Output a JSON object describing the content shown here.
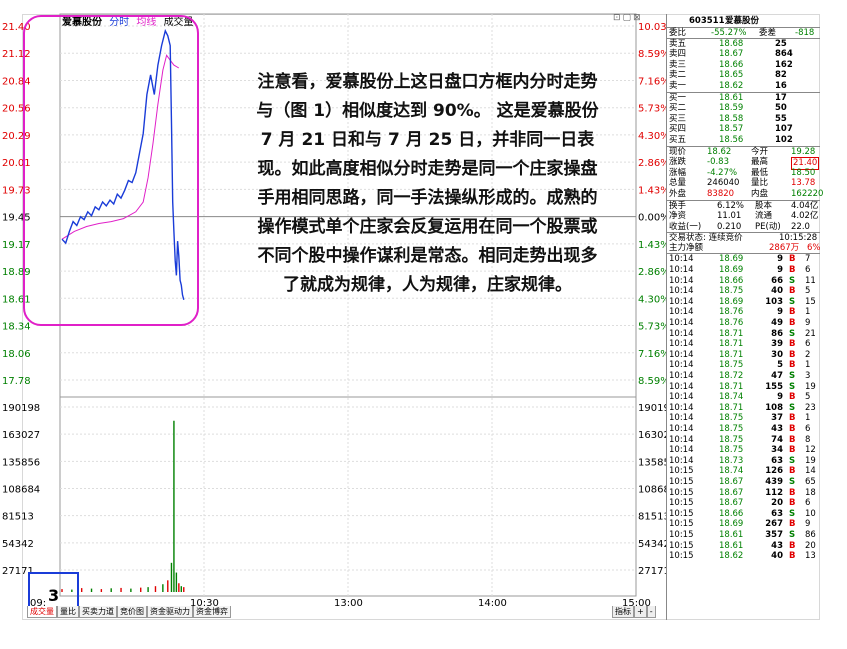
{
  "title_bar": {
    "stock_name": "爱慕股份",
    "tab_intraday": "分时",
    "tab_avg": "均线",
    "tab_volume": "成交量"
  },
  "window_icons": [
    "⊡",
    "▢",
    "⊠"
  ],
  "price_axis": {
    "left": [
      {
        "v": "21.40",
        "c": "red"
      },
      {
        "v": "21.12",
        "c": "red"
      },
      {
        "v": "20.84",
        "c": "red"
      },
      {
        "v": "20.56",
        "c": "red"
      },
      {
        "v": "20.29",
        "c": "red"
      },
      {
        "v": "20.01",
        "c": "red"
      },
      {
        "v": "19.73",
        "c": "red"
      },
      {
        "v": "19.45",
        "c": "black"
      },
      {
        "v": "19.17",
        "c": "green"
      },
      {
        "v": "18.89",
        "c": "green"
      },
      {
        "v": "18.61",
        "c": "green"
      },
      {
        "v": "18.34",
        "c": "green"
      },
      {
        "v": "18.06",
        "c": "green"
      },
      {
        "v": "17.78",
        "c": "green"
      }
    ],
    "right": [
      {
        "v": "10.03%",
        "c": "red"
      },
      {
        "v": "8.59%",
        "c": "red"
      },
      {
        "v": "7.16%",
        "c": "red"
      },
      {
        "v": "5.73%",
        "c": "red"
      },
      {
        "v": "4.30%",
        "c": "red"
      },
      {
        "v": "2.86%",
        "c": "red"
      },
      {
        "v": "1.43%",
        "c": "red"
      },
      {
        "v": "0.00%",
        "c": "black"
      },
      {
        "v": "1.43%",
        "c": "green"
      },
      {
        "v": "2.86%",
        "c": "green"
      },
      {
        "v": "4.30%",
        "c": "green"
      },
      {
        "v": "5.73%",
        "c": "green"
      },
      {
        "v": "7.16%",
        "c": "green"
      },
      {
        "v": "8.59%",
        "c": "green"
      }
    ]
  },
  "volume_axis": {
    "left": [
      "190198",
      "163027",
      "135856",
      "108684",
      "81513",
      "54342",
      "27171"
    ],
    "right": [
      "190198",
      "163027",
      "135856",
      "108684",
      "81513",
      "54342",
      "27171"
    ]
  },
  "time_axis": [
    "09:",
    "10:30",
    "13:00",
    "14:00",
    "15:00"
  ],
  "annotation": {
    "paragraph": "注意看，爱慕股份上这日盘口方框内分时走势与（图 1）相似度达到 90%。 这是爱慕股份 7 月 21 日和与 7 月 25 日，并非同一日表现。如此高度相似分时走势是同一个庄家操盘手用相同思路，同一手法操纵形成的。成熟的操作模式单个庄家会反复运用在同一个股票或不同个股中操作谋利是常态。相同走势出现多了就成为规律，人为规律，庄家规律。",
    "number": "3"
  },
  "bottom_tabs": [
    "成交量",
    "量比",
    "买卖力道",
    "竞价图",
    "资金驱动力",
    "资金博弈"
  ],
  "bottom_right_tabs": [
    "指标",
    "+",
    "-"
  ],
  "chart_data": {
    "type": "line",
    "price_series": [
      [
        0,
        19.22
      ],
      [
        3,
        19.18
      ],
      [
        6,
        19.3
      ],
      [
        9,
        19.4
      ],
      [
        12,
        19.36
      ],
      [
        15,
        19.45
      ],
      [
        18,
        19.42
      ],
      [
        21,
        19.5
      ],
      [
        24,
        19.46
      ],
      [
        27,
        19.55
      ],
      [
        30,
        19.52
      ],
      [
        33,
        19.6
      ],
      [
        36,
        19.56
      ],
      [
        39,
        19.62
      ],
      [
        42,
        19.58
      ],
      [
        45,
        19.68
      ],
      [
        48,
        19.64
      ],
      [
        51,
        19.72
      ],
      [
        54,
        19.82
      ],
      [
        57,
        19.8
      ],
      [
        60,
        19.9
      ],
      [
        63,
        20.1
      ],
      [
        66,
        20.3
      ],
      [
        69,
        20.7
      ],
      [
        72,
        20.9
      ],
      [
        75,
        20.7
      ],
      [
        78,
        21.0
      ],
      [
        81,
        21.2
      ],
      [
        84,
        21.35
      ],
      [
        86,
        21.3
      ],
      [
        88,
        21.2
      ],
      [
        89,
        20.4
      ],
      [
        90,
        19.6
      ],
      [
        91,
        19.3
      ],
      [
        92,
        19.0
      ],
      [
        93,
        18.85
      ],
      [
        94,
        19.2
      ],
      [
        95,
        19.05
      ],
      [
        96,
        18.8
      ],
      [
        97,
        18.75
      ],
      [
        98,
        18.65
      ],
      [
        99,
        18.6
      ]
    ],
    "avg_series": [
      [
        0,
        19.22
      ],
      [
        10,
        19.3
      ],
      [
        20,
        19.35
      ],
      [
        30,
        19.38
      ],
      [
        40,
        19.4
      ],
      [
        50,
        19.43
      ],
      [
        60,
        19.5
      ],
      [
        66,
        19.6
      ],
      [
        70,
        19.85
      ],
      [
        74,
        20.2
      ],
      [
        78,
        20.6
      ],
      [
        82,
        20.95
      ],
      [
        85,
        21.1
      ],
      [
        88,
        21.05
      ],
      [
        91,
        21.0
      ],
      [
        95,
        20.97
      ]
    ],
    "volume_series": [
      [
        0,
        3000
      ],
      [
        8,
        2500
      ],
      [
        16,
        4000
      ],
      [
        24,
        3500
      ],
      [
        32,
        3000
      ],
      [
        40,
        3800
      ],
      [
        48,
        4200
      ],
      [
        56,
        3500
      ],
      [
        64,
        4500
      ],
      [
        70,
        5000
      ],
      [
        76,
        6000
      ],
      [
        82,
        8000
      ],
      [
        86,
        12000
      ],
      [
        89,
        30000
      ],
      [
        91,
        176000
      ],
      [
        93,
        20000
      ],
      [
        95,
        9000
      ],
      [
        97,
        6000
      ],
      [
        99,
        5000
      ]
    ],
    "ylim": [
      17.78,
      21.4
    ],
    "vlim": [
      0,
      190198
    ],
    "xlim": [
      0,
      100
    ]
  },
  "quote_panel": {
    "code": "603511",
    "name": "爱慕股份",
    "webi_label": "委比",
    "webi_value": "-55.27%",
    "weicha_label": "委差",
    "weicha_value": "-818",
    "sell": [
      {
        "label": "卖五",
        "price": "18.68",
        "vol": "25"
      },
      {
        "label": "卖四",
        "price": "18.67",
        "vol": "864"
      },
      {
        "label": "卖三",
        "price": "18.66",
        "vol": "162"
      },
      {
        "label": "卖二",
        "price": "18.65",
        "vol": "82"
      },
      {
        "label": "卖一",
        "price": "18.62",
        "vol": "16"
      }
    ],
    "buy": [
      {
        "label": "买一",
        "price": "18.61",
        "vol": "17"
      },
      {
        "label": "买二",
        "price": "18.59",
        "vol": "50"
      },
      {
        "label": "买三",
        "price": "18.58",
        "vol": "55"
      },
      {
        "label": "买四",
        "price": "18.57",
        "vol": "107"
      },
      {
        "label": "买五",
        "price": "18.56",
        "vol": "102"
      }
    ],
    "stats": [
      {
        "l1": "现价",
        "v1": "18.62",
        "c1": "green",
        "l2": "今开",
        "v2": "19.28",
        "c2": "green"
      },
      {
        "l1": "涨跌",
        "v1": "-0.83",
        "c1": "green",
        "l2": "最高",
        "v2": "21.40",
        "c2": "redbox"
      },
      {
        "l1": "涨幅",
        "v1": "-4.27%",
        "c1": "green",
        "l2": "最低",
        "v2": "18.50",
        "c2": "green"
      },
      {
        "l1": "总量",
        "v1": "246040",
        "c1": "black",
        "l2": "量比",
        "v2": "13.78",
        "c2": "red"
      },
      {
        "l1": "外盘",
        "v1": "83820",
        "c1": "red",
        "l2": "内盘",
        "v2": "162220",
        "c2": "green"
      }
    ],
    "stats2": [
      {
        "l1": "换手",
        "v1": "6.12%",
        "l2": "股本",
        "v2": "4.04亿"
      },
      {
        "l1": "净资",
        "v1": "11.01",
        "l2": "流通",
        "v2": "4.02亿"
      },
      {
        "l1": "收益(一)",
        "v1": "0.210",
        "l2": "PE(动)",
        "v2": "22.0"
      }
    ],
    "status_label": "交易状态: 连续竞价",
    "status_time": "10:15:28",
    "fund_label": "主力净额",
    "fund_value": "2867万",
    "fund_pct": "6%",
    "ticks": [
      [
        "10:14",
        "18.69",
        "9",
        "B",
        "7"
      ],
      [
        "10:14",
        "18.69",
        "9",
        "B",
        "6"
      ],
      [
        "10:14",
        "18.66",
        "66",
        "S",
        "11"
      ],
      [
        "10:14",
        "18.75",
        "40",
        "B",
        "5"
      ],
      [
        "10:14",
        "18.69",
        "103",
        "S",
        "15"
      ],
      [
        "10:14",
        "18.76",
        "9",
        "B",
        "1"
      ],
      [
        "10:14",
        "18.76",
        "49",
        "B",
        "9"
      ],
      [
        "10:14",
        "18.71",
        "86",
        "S",
        "21"
      ],
      [
        "10:14",
        "18.71",
        "39",
        "B",
        "6"
      ],
      [
        "10:14",
        "18.71",
        "30",
        "B",
        "2"
      ],
      [
        "10:14",
        "18.75",
        "5",
        "B",
        "1"
      ],
      [
        "10:14",
        "18.72",
        "47",
        "S",
        "3"
      ],
      [
        "10:14",
        "18.71",
        "155",
        "S",
        "19"
      ],
      [
        "10:14",
        "18.74",
        "9",
        "B",
        "5"
      ],
      [
        "10:14",
        "18.71",
        "108",
        "S",
        "23"
      ],
      [
        "10:14",
        "18.75",
        "37",
        "B",
        "1"
      ],
      [
        "10:14",
        "18.75",
        "43",
        "B",
        "6"
      ],
      [
        "10:14",
        "18.75",
        "74",
        "B",
        "8"
      ],
      [
        "10:14",
        "18.75",
        "34",
        "B",
        "12"
      ],
      [
        "10:14",
        "18.73",
        "63",
        "S",
        "19"
      ],
      [
        "10:15",
        "18.74",
        "126",
        "B",
        "14"
      ],
      [
        "10:15",
        "18.67",
        "439",
        "S",
        "65"
      ],
      [
        "10:15",
        "18.67",
        "112",
        "B",
        "18"
      ],
      [
        "10:15",
        "18.67",
        "20",
        "B",
        "6"
      ],
      [
        "10:15",
        "18.66",
        "63",
        "S",
        "10"
      ],
      [
        "10:15",
        "18.69",
        "267",
        "B",
        "9"
      ],
      [
        "10:15",
        "18.61",
        "357",
        "S",
        "86"
      ],
      [
        "10:15",
        "18.61",
        "43",
        "B",
        "20"
      ],
      [
        "10:15",
        "18.62",
        "40",
        "B",
        "13"
      ]
    ]
  }
}
